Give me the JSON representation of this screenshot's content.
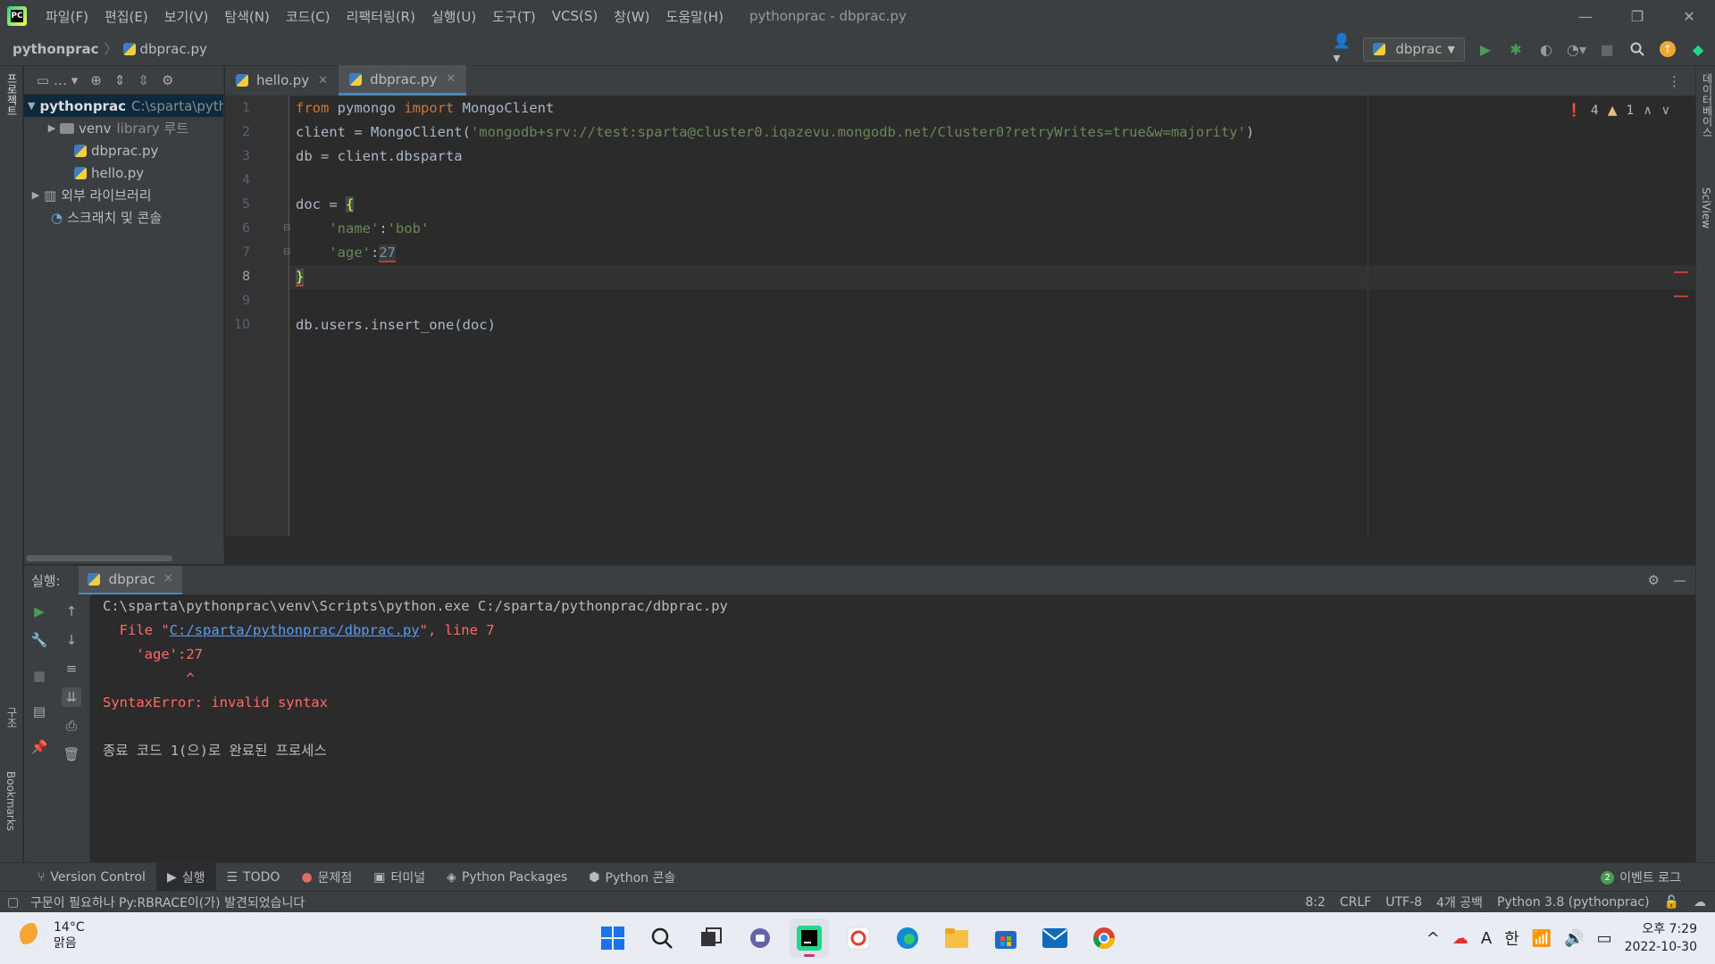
{
  "window": {
    "title": "pythonprac - dbprac.py",
    "menu": [
      "파일(F)",
      "편집(E)",
      "보기(V)",
      "탐색(N)",
      "코드(C)",
      "리팩터링(R)",
      "실행(U)",
      "도구(T)",
      "VCS(S)",
      "창(W)",
      "도움말(H)"
    ],
    "controls": [
      "—",
      "❐",
      "✕"
    ]
  },
  "navbar": {
    "project": "pythonprac",
    "file": "dbprac.py",
    "run_config": "dbprac"
  },
  "left_strip": {
    "project_label": "프로젝트",
    "structure_label": "구조",
    "bookmarks_label": "Bookmarks"
  },
  "right_strip": {
    "database_label": "데이터베이스",
    "sciview_label": "SciView"
  },
  "project_tree": {
    "toolbar_dots": "…",
    "root": {
      "name": "pythonprac",
      "path": "C:\\sparta\\pythonprac"
    },
    "venv": {
      "name": "venv",
      "hint": "library 루트"
    },
    "files": [
      "dbprac.py",
      "hello.py"
    ],
    "external_libs": "외부 라이브러리",
    "scratches": "스크래치 및 콘솔"
  },
  "tabs": [
    {
      "label": "hello.py",
      "active": false
    },
    {
      "label": "dbprac.py",
      "active": true
    }
  ],
  "editor": {
    "line_numbers": [
      "1",
      "2",
      "3",
      "4",
      "5",
      "6",
      "7",
      "8",
      "9",
      "10"
    ],
    "current_line": 8,
    "lines": {
      "l1_from": "from",
      "l1_mod": " pymongo ",
      "l1_import": "import",
      "l1_name": " MongoClient",
      "l2_pre": "client = MongoClient(",
      "l2_str": "'mongodb+srv://test:sparta@cluster0.iqazevu.mongodb.net/Cluster0?retryWrites=true&w=majority'",
      "l2_post": ")",
      "l3": "db = client.dbsparta",
      "l5_pre": "doc = ",
      "l5_brace": "{",
      "l6_pre": "    ",
      "l6_key": "'name'",
      "l6_colon": ":",
      "l6_val": "'bob'",
      "l7_pre": "    ",
      "l7_key": "'age'",
      "l7_colon": ":",
      "l7_val": "27",
      "l8": "}",
      "l10": "db.users.insert_one(doc)"
    },
    "inspections": {
      "errors": "4",
      "warnings": "1"
    }
  },
  "run_panel": {
    "label": "실행:",
    "tab": "dbprac",
    "output": {
      "cmd": "C:\\sparta\\pythonprac\\venv\\Scripts\\python.exe C:/sparta/pythonprac/dbprac.py",
      "file_pre": "  File \"",
      "file_link": "C:/sparta/pythonprac/dbprac.py",
      "file_post": "\", line 7",
      "code": "    'age':27",
      "caret": "          ^",
      "error": "SyntaxError: invalid syntax",
      "exit": "종료 코드 1(으)로 완료된 프로세스"
    }
  },
  "tool_windows": [
    {
      "label": "Version Control",
      "icon": "branch-icon"
    },
    {
      "label": "실행",
      "icon": "play-icon",
      "active": true
    },
    {
      "label": "TODO",
      "icon": "list-icon"
    },
    {
      "label": "문제점",
      "icon": "error-icon"
    },
    {
      "label": "터미널",
      "icon": "terminal-icon"
    },
    {
      "label": "Python Packages",
      "icon": "layers-icon"
    },
    {
      "label": "Python 콘솔",
      "icon": "python-icon"
    }
  ],
  "event_log": {
    "count": "2",
    "label": "이벤트 로그"
  },
  "status": {
    "message": "구문이 필요하나 Py:RBRACE이(가) 발견되었습니다",
    "position": "8:2",
    "line_sep": "CRLF",
    "encoding": "UTF-8",
    "indent": "4개 공백",
    "interpreter": "Python 3.8 (pythonprac)"
  },
  "taskbar": {
    "temp": "14°C",
    "weather": "맑음",
    "ime_a": "A",
    "ime_lang": "한",
    "time": "오후 7:29",
    "date": "2022-10-30"
  },
  "colors": {
    "accent": "#4a88c7",
    "error": "#ff6b68",
    "keyword": "#cc7832",
    "string": "#6a8759",
    "number": "#6897bb"
  }
}
